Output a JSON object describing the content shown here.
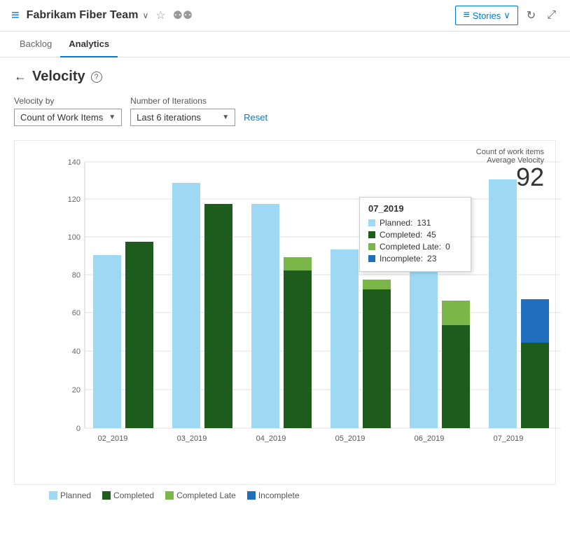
{
  "header": {
    "icon": "≡",
    "title": "Fabrikam Fiber Team",
    "chevron": "∨",
    "star": "☆",
    "team_icon": "👥",
    "stories_label": "Stories",
    "stories_chevron": "∨",
    "refresh_icon": "↻",
    "expand_icon": "⤢"
  },
  "nav": {
    "tabs": [
      {
        "label": "Backlog",
        "active": false
      },
      {
        "label": "Analytics",
        "active": true
      }
    ]
  },
  "page": {
    "back_icon": "←",
    "title": "Velocity",
    "help_icon": "?"
  },
  "filters": {
    "velocity_by_label": "Velocity by",
    "velocity_by_value": "Count of Work Items",
    "iterations_label": "Number of Iterations",
    "iterations_value": "Last 6 iterations",
    "reset_label": "Reset"
  },
  "chart": {
    "velocity_items_label": "Count of work items",
    "average_velocity_label": "Average Velocity",
    "average_velocity_value": "92",
    "y_axis": [
      0,
      20,
      40,
      60,
      80,
      100,
      120,
      140
    ],
    "tooltip": {
      "title": "07_2019",
      "planned_label": "Planned:",
      "planned_value": "131",
      "completed_label": "Completed:",
      "completed_value": "45",
      "completed_late_label": "Completed Late:",
      "completed_late_value": "0",
      "incomplete_label": "Incomplete:",
      "incomplete_value": "23"
    },
    "bars": [
      {
        "label": "02_2019",
        "planned": 91,
        "completed": 98,
        "completed_late": 0,
        "incomplete": 0
      },
      {
        "label": "03_2019",
        "planned": 129,
        "completed": 118,
        "completed_late": 0,
        "incomplete": 0
      },
      {
        "label": "04_2019",
        "planned": 118,
        "completed": 83,
        "completed_late": 7,
        "incomplete": 0
      },
      {
        "label": "05_2019",
        "planned": 94,
        "completed": 73,
        "completed_late": 5,
        "incomplete": 0
      },
      {
        "label": "06_2019",
        "planned": 91,
        "completed": 54,
        "completed_late": 13,
        "incomplete": 0
      },
      {
        "label": "07_2019",
        "planned": 131,
        "completed": 45,
        "completed_late": 0,
        "incomplete": 23
      }
    ]
  },
  "legend": {
    "items": [
      {
        "label": "Planned",
        "color": "#9dd9f3"
      },
      {
        "label": "Completed",
        "color": "#1e5c1e"
      },
      {
        "label": "Completed Late",
        "color": "#7ab648"
      },
      {
        "label": "Incomplete",
        "color": "#1f6fbe"
      }
    ]
  }
}
